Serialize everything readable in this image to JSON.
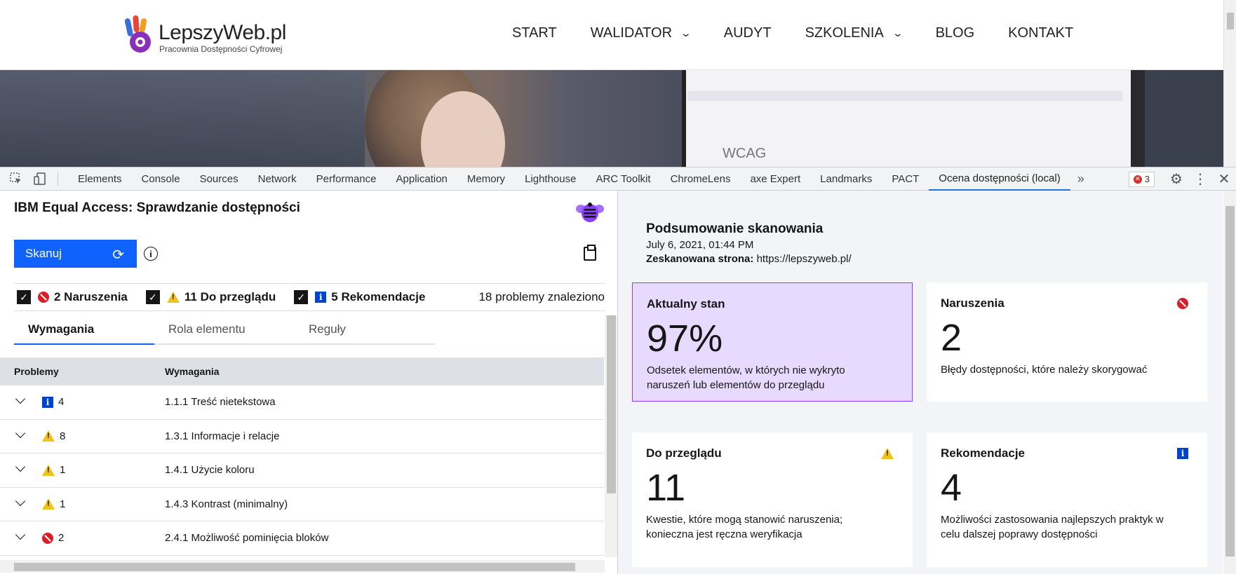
{
  "site": {
    "logo_name": "LepszyWeb.pl",
    "logo_sub": "Pracownia Dostępności Cyfrowej",
    "nav": [
      {
        "label": "START",
        "dropdown": false
      },
      {
        "label": "WALIDATOR",
        "dropdown": true
      },
      {
        "label": "AUDYT",
        "dropdown": false
      },
      {
        "label": "SZKOLENIA",
        "dropdown": true
      },
      {
        "label": "BLOG",
        "dropdown": false
      },
      {
        "label": "KONTAKT",
        "dropdown": false
      }
    ],
    "hero_text": "WCAG"
  },
  "devtools": {
    "tabs": [
      "Elements",
      "Console",
      "Sources",
      "Network",
      "Performance",
      "Application",
      "Memory",
      "Lighthouse",
      "ARC Toolkit",
      "ChromeLens",
      "axe Expert",
      "Landmarks",
      "PACT",
      "Ocena dostępności (local)"
    ],
    "active_tab": "Ocena dostępności (local)",
    "error_count": "3"
  },
  "checker": {
    "title": "IBM Equal Access: Sprawdzanie dostępności",
    "scan_label": "Skanuj",
    "filters": {
      "violations": "2 Naruszenia",
      "review": "11 Do przeglądu",
      "recommendations": "5 Rekomendacje",
      "total": "18 problemy znaleziono"
    },
    "tabs": [
      "Wymagania",
      "Rola elementu",
      "Reguły"
    ],
    "table_headers": [
      "Problemy",
      "Wymagania"
    ],
    "rows": [
      {
        "type": "recommendation",
        "count": "4",
        "requirement": "1.1.1 Treść nietekstowa"
      },
      {
        "type": "review",
        "count": "8",
        "requirement": "1.3.1 Informacje i relacje"
      },
      {
        "type": "review",
        "count": "1",
        "requirement": "1.4.1 Użycie koloru"
      },
      {
        "type": "review",
        "count": "1",
        "requirement": "1.4.3 Kontrast (minimalny)"
      },
      {
        "type": "violation",
        "count": "2",
        "requirement": "2.4.1 Możliwość pominięcia bloków"
      }
    ]
  },
  "summary": {
    "title": "Podsumowanie skanowania",
    "date": "July 6, 2021, 01:44 PM",
    "url_label": "Zeskanowana strona:",
    "url": "https://lepszyweb.pl/",
    "cards": {
      "current": {
        "title": "Aktualny stan",
        "value": "97%",
        "desc": "Odsetek elementów, w których nie wykryto naruszeń lub elementów do przeglądu"
      },
      "violations": {
        "title": "Naruszenia",
        "value": "2",
        "desc": "Błędy dostępności, które należy skorygować"
      },
      "review": {
        "title": "Do przeglądu",
        "value": "11",
        "desc": "Kwestie, które mogą stanowić naruszenia; konieczna jest ręczna weryfikacja"
      },
      "recommendations": {
        "title": "Rekomendacje",
        "value": "4",
        "desc": "Możliwości zastosowania najlepszych praktyk w celu dalszej poprawy dostępności"
      }
    }
  },
  "colors": {
    "accent": "#0f62fe",
    "violation": "#da1e28",
    "review": "#f1c21b",
    "recommendation": "#0043ce",
    "current_card": "#e8daff"
  }
}
